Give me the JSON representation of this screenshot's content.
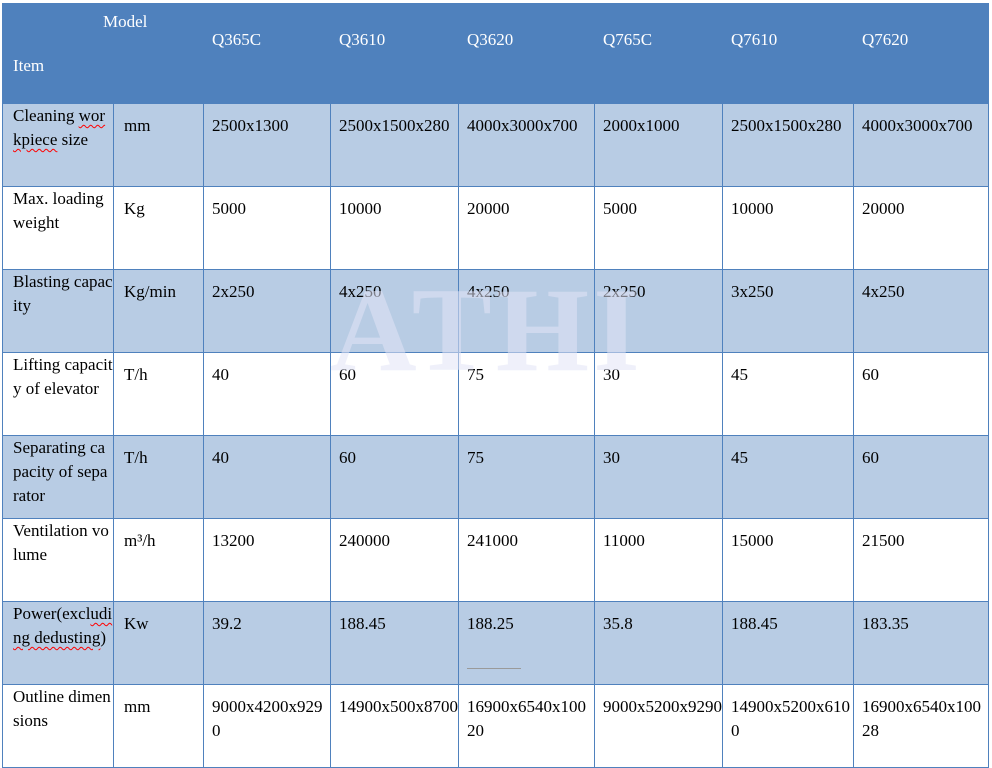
{
  "header": {
    "model_label": "Model",
    "item_label": "Item",
    "models": [
      "Q365C",
      "Q3610",
      "Q3620",
      "Q765C",
      "Q7610",
      "Q7620"
    ]
  },
  "rows": [
    {
      "item_before": "Cleaning ",
      "item_squiggle": "workpiece",
      "item_after": " size",
      "unit": "mm",
      "values": [
        "2500x1300",
        "2500x1500x280",
        "4000x3000x700",
        "2000x1000",
        "2500x1500x280",
        "4000x3000x700"
      ]
    },
    {
      "item_before": "Max. loading weight",
      "item_squiggle": "",
      "item_after": "",
      "unit": "Kg",
      "values": [
        "5000",
        "10000",
        "20000",
        "5000",
        "10000",
        "20000"
      ]
    },
    {
      "item_before": "Blasting capacity",
      "item_squiggle": "",
      "item_after": "",
      "unit": "Kg/min",
      "values": [
        "2x250",
        "4x250",
        "4x250",
        "2x250",
        "3x250",
        "4x250"
      ]
    },
    {
      "item_before": "Lifting capacity of elevator",
      "item_squiggle": "",
      "item_after": "",
      "unit": "T/h",
      "values": [
        "40",
        "60",
        "75",
        "30",
        "45",
        "60"
      ]
    },
    {
      "item_before": "Separating capacity of separator",
      "item_squiggle": "",
      "item_after": "",
      "unit": "T/h",
      "values": [
        "40",
        "60",
        "75",
        "30",
        "45",
        "60"
      ]
    },
    {
      "item_before": "Ventilation volume",
      "item_squiggle": "",
      "item_after": "",
      "unit": "m³/h",
      "values": [
        "13200",
        "240000",
        "241000",
        "11000",
        "15000",
        "21500"
      ]
    },
    {
      "item_before": "Power(excl",
      "item_squiggle": "uding dedusting",
      "item_after": ")",
      "unit": "Kw",
      "values": [
        "39.2",
        "188.45",
        "188.25",
        "35.8",
        "188.45",
        "183.35"
      ]
    },
    {
      "item_before": "Outline dimensions",
      "item_squiggle": "",
      "item_after": "",
      "unit": "mm",
      "values": [
        "9000x4200x9290",
        "14900x500x8700",
        "16900x6540x10020",
        "9000x5200x9290",
        "14900x5200x6100",
        "16900x6540x10028"
      ]
    }
  ],
  "watermark": "ATHI",
  "colors": {
    "header_bg": "#4f81bd",
    "shade_bg": "#b8cce4",
    "border": "#4f81bd",
    "watermark": "#e1e4f5"
  }
}
